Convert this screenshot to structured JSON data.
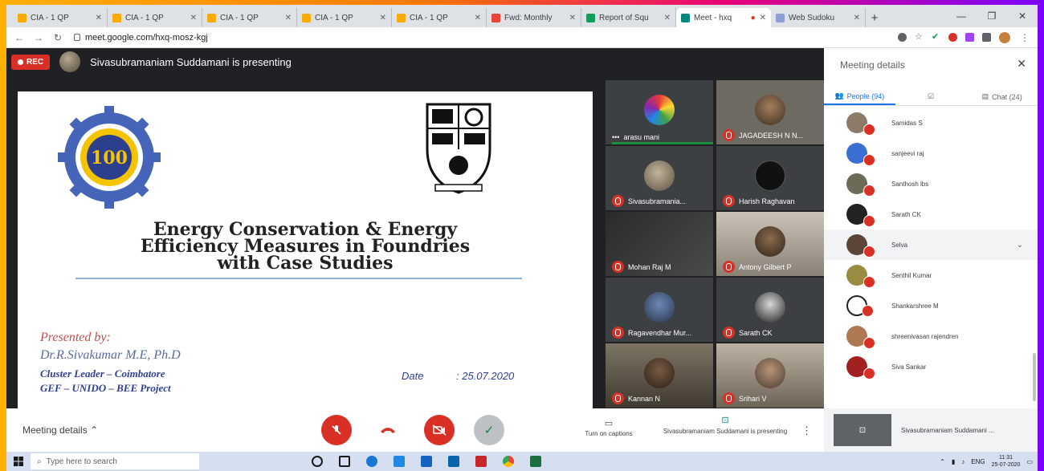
{
  "browser": {
    "tabs": [
      {
        "title": "CIA - 1 QP",
        "color": "#f9ab00"
      },
      {
        "title": "CIA - 1 QP",
        "color": "#f9ab00"
      },
      {
        "title": "CIA - 1 QP",
        "color": "#f9ab00"
      },
      {
        "title": "CIA - 1 QP",
        "color": "#f9ab00"
      },
      {
        "title": "CIA - 1 QP",
        "color": "#f9ab00"
      },
      {
        "title": "Fwd: Monthly",
        "color": "#ea4335"
      },
      {
        "title": "Report of Squ",
        "color": "#0f9d58"
      },
      {
        "title": "Meet - hxq",
        "color": "#00897b"
      },
      {
        "title": "Web Sudoku",
        "color": "#8e9fd6"
      }
    ],
    "url": "meet.google.com/hxq-mosz-kgj"
  },
  "meet": {
    "rec_label": "REC",
    "presenting_text": "Sivasubramaniam Suddamani is presenting"
  },
  "slide": {
    "logo_text": "100",
    "title_lines": [
      "Energy Conservation & Energy",
      "Efficiency Measures in Foundries",
      "with Case Studies"
    ],
    "presented_by": "Presented by:",
    "presenter": "Dr.R.Sivakumar M.E, Ph.D",
    "line1": "Cluster Leader – Coimbatore",
    "line2": "GEF – UNIDO – BEE Project",
    "date_label": "Date",
    "date_value": ": 25.07.2020"
  },
  "tiles": [
    {
      "name": "arasu mani"
    },
    {
      "name": "JAGADEESH N N..."
    },
    {
      "name": "Sivasubramania..."
    },
    {
      "name": "Harish Raghavan"
    },
    {
      "name": "Mohan Raj M"
    },
    {
      "name": "Antony Gilbert P"
    },
    {
      "name": "Ragavendhar Mur..."
    },
    {
      "name": "Sarath CK"
    },
    {
      "name": "Kannan N"
    },
    {
      "name": "Srihari V"
    }
  ],
  "panel": {
    "title": "Meeting details",
    "people_tab": "People (94)",
    "chat_tab": "Chat (24)",
    "people": [
      {
        "name": "Samidas S",
        "color": "#8d7b6a"
      },
      {
        "name": "sanjeevi raj",
        "color": "#3b6fd1"
      },
      {
        "name": "Santhosh lbs",
        "color": "#6b6b58"
      },
      {
        "name": "Sarath CK",
        "color": "#222222"
      },
      {
        "name": "Selva",
        "color": "#5a4538"
      },
      {
        "name": "Senthil Kumar",
        "color": "#9b8a42"
      },
      {
        "name": "Shankarshree M",
        "color": "#ffffff"
      },
      {
        "name": "shreenivasan rajendren",
        "color": "#b07852"
      },
      {
        "name": "Siva Sankar",
        "color": "#a32020"
      }
    ]
  },
  "controls": {
    "meeting_details": "Meeting details",
    "captions": "Turn on captions",
    "presenting": "Sivasubramaniam Suddamani is presenting",
    "self_name": "Sivasubramaniam Suddamani ..."
  },
  "taskbar": {
    "search_placeholder": "Type here to search",
    "lang": "ENG",
    "time": "11:31",
    "date": "25-07-2020"
  }
}
